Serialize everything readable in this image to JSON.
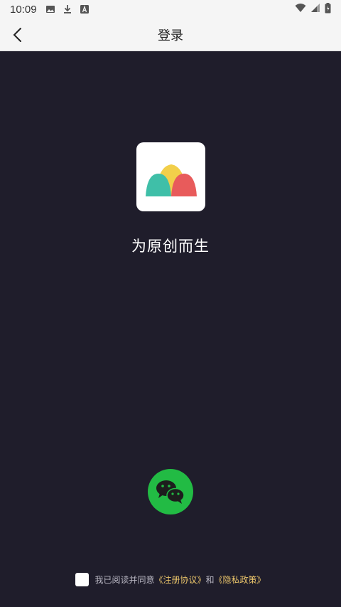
{
  "status_bar": {
    "time": "10:09",
    "left_icons": [
      "image-icon",
      "download-icon",
      "a-icon"
    ],
    "right_icons": [
      "wifi-icon",
      "signal-icon",
      "battery-icon"
    ]
  },
  "header": {
    "title": "登录",
    "back_icon": "chevron-left-icon"
  },
  "main": {
    "logo_icon": "app-logo-icon",
    "slogan": "为原创而生",
    "wechat_login_icon": "wechat-icon"
  },
  "agreement": {
    "prefix": "我已阅读并同意",
    "terms_link": "《注册协议》",
    "conjunction": "和",
    "privacy_link": "《隐私政策》"
  },
  "colors": {
    "background": "#1f1d2b",
    "wechat_green": "#22bb44",
    "link_gold": "#e8c36a",
    "logo_yellow": "#f2cf4a",
    "logo_teal": "#3fbfa8",
    "logo_red": "#e85b5b"
  }
}
